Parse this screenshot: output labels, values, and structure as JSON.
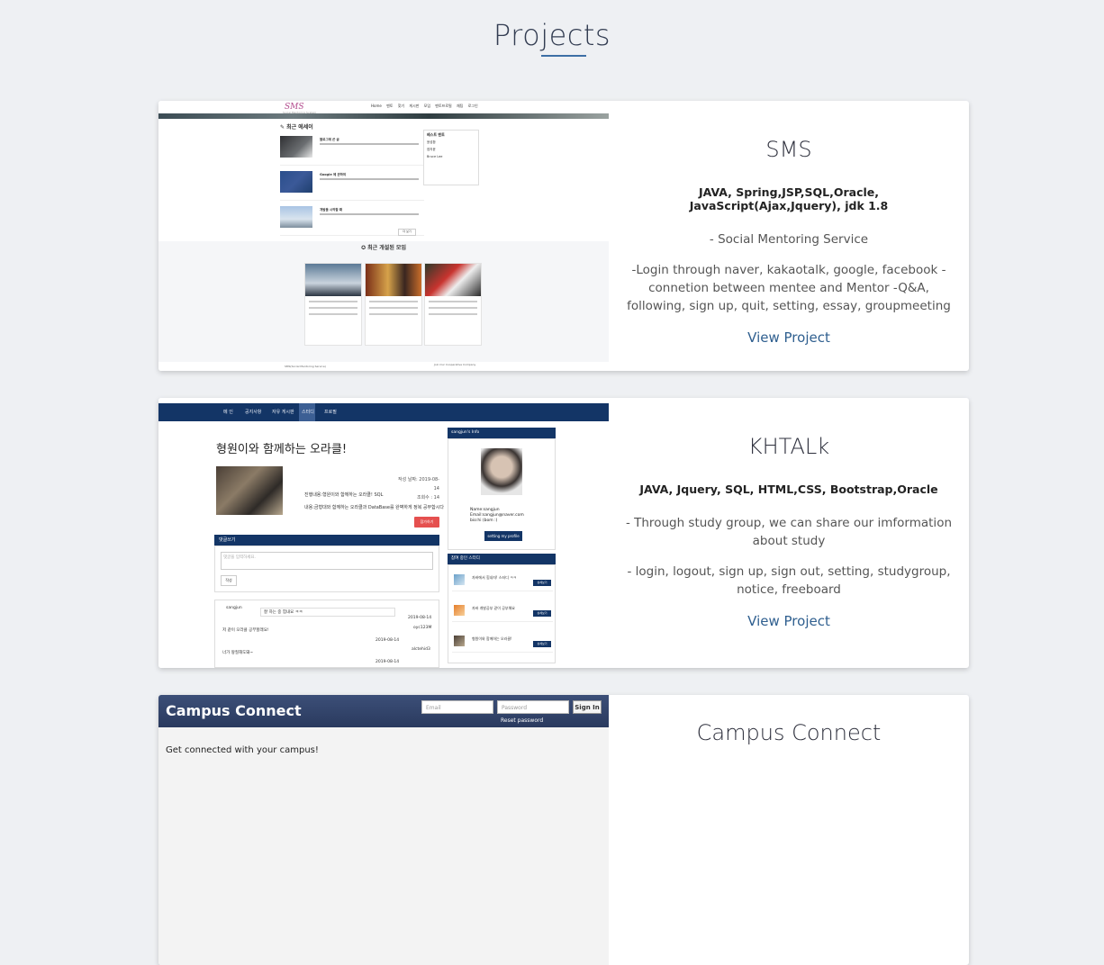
{
  "section": {
    "title": "Projects"
  },
  "colors": {
    "accent": "#3d6fa5",
    "link": "#2f5f8f",
    "page_bg": "#eef0f3"
  },
  "projects": [
    {
      "name": "SMS",
      "tech": "JAVA, Spring,JSP,SQL,Oracle, JavaScript(Ajax,Jquery), jdk 1.8",
      "description": "- Social Mentoring Service",
      "features": "-Login through naver, kakaotalk, google, facebook - connetion between mentee and Mentor -Q&A, following, sign up, quit, setting, essay, groupmeeting",
      "link": "View Project",
      "screenshot": {
        "logo": "SMS",
        "logo_sub": "Social Mentoring System",
        "nav": "Home 멘토 찾기 게시판 모임 멘토프로필 채팅 로그인",
        "recent_essays": "✎ 최근 에세이",
        "posts": [
          "블로그에 쓴 글",
          "Google 에 관하여",
          "개발을 시작할 때"
        ],
        "more": "더 보기",
        "best": "베스트 멘토",
        "best_list": [
          "윤성환",
          "염지윤",
          "Bruce Lee"
        ],
        "recent_groups": "✪ 최근 개설된 모임",
        "footer": "SMS(Social Mentoring Service)",
        "footer_right": "Join Our Cooperative Company"
      }
    },
    {
      "name": "KHTALk",
      "tech": "JAVA, Jquery, SQL, HTML,CSS, Bootstrap,Oracle",
      "description": "- Through study group, we can share our imformation about study",
      "features": "- login, logout, sign up, sign out, setting, studygroup, notice, freeboard",
      "link": "View Project",
      "screenshot": {
        "nav": [
          "메 인",
          "공지사항",
          "자유 게시판",
          "스터디",
          "프로필"
        ],
        "title": "형원이와 함께하는 오라클!",
        "meta_date": "작성 날짜: 2019-08-14",
        "meta_views": "조회수 : 14",
        "content1": "진행내용:형원이와 함께하는 오라클! SQL",
        "content2": "내용:금형대와 함께하는 오라클과 DataBase를 완벽하게 정복 공부합시다",
        "join_btn": "참가하기",
        "reply_header": "댓글쓰기",
        "reply_placeholder": "댓글을 입력하세요.",
        "reply_btn": "작성",
        "comments": [
          "sangjun",
          "잘 하는 중 힘내요 ㅋㅋ",
          "2019-08-14",
          "oyc123M",
          "저 같이 오라클 공부할래요!",
          "2019-08-14",
          "alctehid3",
          "너가 왕질해도돼~",
          "2019-08-14"
        ],
        "profile_header": "sangjun's Info",
        "profile_name": "Name:sangjun",
        "profile_email": "Email:sangjun@naver.com",
        "profile_bio": "bio:hi (bom :)",
        "setting_btn": "setting my profile",
        "groups_header": "참여 중인 스터디",
        "groups": [
          "자바에서 힘내자! 스터디 ㅋㅋ",
          "자바 개발공부 같이 공부해요",
          "형원이와 함께하는 오라클!"
        ],
        "group_btn": "상세보기"
      }
    },
    {
      "name": "Campus Connect",
      "screenshot": {
        "logo": "Campus Connect",
        "email_placeholder": "Email",
        "password_placeholder": "Password",
        "signin": "Sign In",
        "reset": "Reset password",
        "tagline": "Get connected with your campus!"
      }
    }
  ]
}
